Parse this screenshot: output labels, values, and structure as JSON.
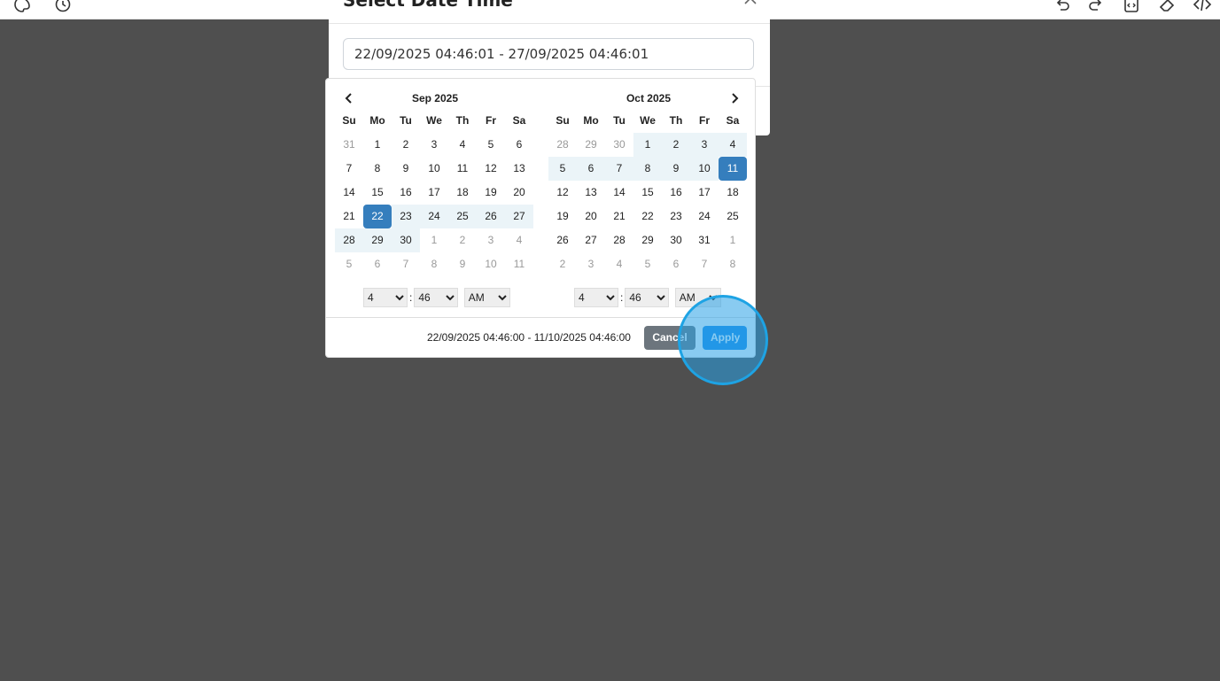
{
  "toolbar": {
    "left_icons": [
      "palette-icon",
      "history-icon"
    ],
    "right_icons": [
      "undo-icon",
      "redo-icon",
      "code-file-icon",
      "eraser-icon",
      "code-icon"
    ]
  },
  "modal": {
    "title": "Select Date Time",
    "close_icon": "close-icon",
    "input_value": "22/09/2025 04:46:01 - 27/09/2025 04:46:01"
  },
  "picker": {
    "weekdays": [
      "Su",
      "Mo",
      "Tu",
      "We",
      "Th",
      "Fr",
      "Sa"
    ],
    "left": {
      "month": "Sep 2025",
      "days": [
        [
          "31",
          "off"
        ],
        [
          "1",
          ""
        ],
        [
          "2",
          ""
        ],
        [
          "3",
          ""
        ],
        [
          "4",
          ""
        ],
        [
          "5",
          ""
        ],
        [
          "6",
          ""
        ],
        [
          "7",
          ""
        ],
        [
          "8",
          ""
        ],
        [
          "9",
          ""
        ],
        [
          "10",
          ""
        ],
        [
          "11",
          ""
        ],
        [
          "12",
          ""
        ],
        [
          "13",
          ""
        ],
        [
          "14",
          ""
        ],
        [
          "15",
          ""
        ],
        [
          "16",
          ""
        ],
        [
          "17",
          ""
        ],
        [
          "18",
          ""
        ],
        [
          "19",
          ""
        ],
        [
          "20",
          ""
        ],
        [
          "21",
          ""
        ],
        [
          "22",
          "active"
        ],
        [
          "23",
          "inrange"
        ],
        [
          "24",
          "inrange"
        ],
        [
          "25",
          "inrange"
        ],
        [
          "26",
          "inrange"
        ],
        [
          "27",
          "inrange"
        ],
        [
          "28",
          "inrange"
        ],
        [
          "29",
          "inrange"
        ],
        [
          "30",
          "inrange"
        ],
        [
          "1",
          "off"
        ],
        [
          "2",
          "off"
        ],
        [
          "3",
          "off"
        ],
        [
          "4",
          "off"
        ],
        [
          "5",
          "off"
        ],
        [
          "6",
          "off"
        ],
        [
          "7",
          "off"
        ],
        [
          "8",
          "off"
        ],
        [
          "9",
          "off"
        ],
        [
          "10",
          "off"
        ],
        [
          "11",
          "off"
        ]
      ],
      "hour": "4",
      "minute": "46",
      "ampm": "AM"
    },
    "right": {
      "month": "Oct 2025",
      "days": [
        [
          "28",
          "off"
        ],
        [
          "29",
          "off"
        ],
        [
          "30",
          "off"
        ],
        [
          "1",
          "inrange"
        ],
        [
          "2",
          "inrange"
        ],
        [
          "3",
          "inrange"
        ],
        [
          "4",
          "inrange"
        ],
        [
          "5",
          "inrange"
        ],
        [
          "6",
          "inrange"
        ],
        [
          "7",
          "inrange"
        ],
        [
          "8",
          "inrange"
        ],
        [
          "9",
          "inrange"
        ],
        [
          "10",
          "inrange"
        ],
        [
          "11",
          "active"
        ],
        [
          "12",
          ""
        ],
        [
          "13",
          ""
        ],
        [
          "14",
          ""
        ],
        [
          "15",
          ""
        ],
        [
          "16",
          ""
        ],
        [
          "17",
          ""
        ],
        [
          "18",
          ""
        ],
        [
          "19",
          ""
        ],
        [
          "20",
          ""
        ],
        [
          "21",
          ""
        ],
        [
          "22",
          ""
        ],
        [
          "23",
          ""
        ],
        [
          "24",
          ""
        ],
        [
          "25",
          ""
        ],
        [
          "26",
          ""
        ],
        [
          "27",
          ""
        ],
        [
          "28",
          ""
        ],
        [
          "29",
          ""
        ],
        [
          "30",
          ""
        ],
        [
          "31",
          ""
        ],
        [
          "1",
          "off"
        ],
        [
          "2",
          "off"
        ],
        [
          "3",
          "off"
        ],
        [
          "4",
          "off"
        ],
        [
          "5",
          "off"
        ],
        [
          "6",
          "off"
        ],
        [
          "7",
          "off"
        ],
        [
          "8",
          "off"
        ]
      ],
      "hour": "4",
      "minute": "46",
      "ampm": "AM"
    },
    "selected_range": "22/09/2025 04:46:00 - 11/10/2025 04:46:00",
    "cancel_label": "Cancel",
    "apply_label": "Apply"
  },
  "colors": {
    "backdrop": "#4f4f4f",
    "active_day": "#357ebd",
    "in_range": "#ebf4f8",
    "apply": "#1c8de8",
    "cancel": "#6c757d",
    "click_highlight": "#1ea3e4"
  }
}
